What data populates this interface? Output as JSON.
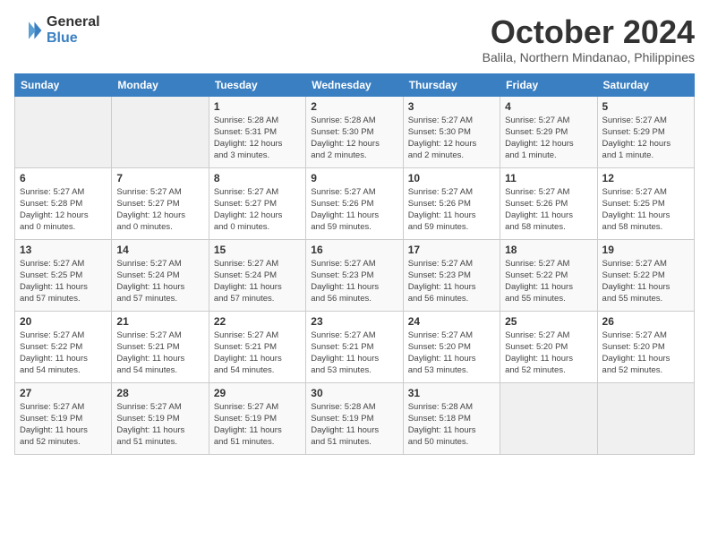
{
  "header": {
    "logo": {
      "general": "General",
      "blue": "Blue"
    },
    "title": "October 2024",
    "subtitle": "Balila, Northern Mindanao, Philippines"
  },
  "calendar": {
    "headers": [
      "Sunday",
      "Monday",
      "Tuesday",
      "Wednesday",
      "Thursday",
      "Friday",
      "Saturday"
    ],
    "weeks": [
      [
        {
          "day": "",
          "info": ""
        },
        {
          "day": "",
          "info": ""
        },
        {
          "day": "1",
          "info": "Sunrise: 5:28 AM\nSunset: 5:31 PM\nDaylight: 12 hours\nand 3 minutes."
        },
        {
          "day": "2",
          "info": "Sunrise: 5:28 AM\nSunset: 5:30 PM\nDaylight: 12 hours\nand 2 minutes."
        },
        {
          "day": "3",
          "info": "Sunrise: 5:27 AM\nSunset: 5:30 PM\nDaylight: 12 hours\nand 2 minutes."
        },
        {
          "day": "4",
          "info": "Sunrise: 5:27 AM\nSunset: 5:29 PM\nDaylight: 12 hours\nand 1 minute."
        },
        {
          "day": "5",
          "info": "Sunrise: 5:27 AM\nSunset: 5:29 PM\nDaylight: 12 hours\nand 1 minute."
        }
      ],
      [
        {
          "day": "6",
          "info": "Sunrise: 5:27 AM\nSunset: 5:28 PM\nDaylight: 12 hours\nand 0 minutes."
        },
        {
          "day": "7",
          "info": "Sunrise: 5:27 AM\nSunset: 5:27 PM\nDaylight: 12 hours\nand 0 minutes."
        },
        {
          "day": "8",
          "info": "Sunrise: 5:27 AM\nSunset: 5:27 PM\nDaylight: 12 hours\nand 0 minutes."
        },
        {
          "day": "9",
          "info": "Sunrise: 5:27 AM\nSunset: 5:26 PM\nDaylight: 11 hours\nand 59 minutes."
        },
        {
          "day": "10",
          "info": "Sunrise: 5:27 AM\nSunset: 5:26 PM\nDaylight: 11 hours\nand 59 minutes."
        },
        {
          "day": "11",
          "info": "Sunrise: 5:27 AM\nSunset: 5:26 PM\nDaylight: 11 hours\nand 58 minutes."
        },
        {
          "day": "12",
          "info": "Sunrise: 5:27 AM\nSunset: 5:25 PM\nDaylight: 11 hours\nand 58 minutes."
        }
      ],
      [
        {
          "day": "13",
          "info": "Sunrise: 5:27 AM\nSunset: 5:25 PM\nDaylight: 11 hours\nand 57 minutes."
        },
        {
          "day": "14",
          "info": "Sunrise: 5:27 AM\nSunset: 5:24 PM\nDaylight: 11 hours\nand 57 minutes."
        },
        {
          "day": "15",
          "info": "Sunrise: 5:27 AM\nSunset: 5:24 PM\nDaylight: 11 hours\nand 57 minutes."
        },
        {
          "day": "16",
          "info": "Sunrise: 5:27 AM\nSunset: 5:23 PM\nDaylight: 11 hours\nand 56 minutes."
        },
        {
          "day": "17",
          "info": "Sunrise: 5:27 AM\nSunset: 5:23 PM\nDaylight: 11 hours\nand 56 minutes."
        },
        {
          "day": "18",
          "info": "Sunrise: 5:27 AM\nSunset: 5:22 PM\nDaylight: 11 hours\nand 55 minutes."
        },
        {
          "day": "19",
          "info": "Sunrise: 5:27 AM\nSunset: 5:22 PM\nDaylight: 11 hours\nand 55 minutes."
        }
      ],
      [
        {
          "day": "20",
          "info": "Sunrise: 5:27 AM\nSunset: 5:22 PM\nDaylight: 11 hours\nand 54 minutes."
        },
        {
          "day": "21",
          "info": "Sunrise: 5:27 AM\nSunset: 5:21 PM\nDaylight: 11 hours\nand 54 minutes."
        },
        {
          "day": "22",
          "info": "Sunrise: 5:27 AM\nSunset: 5:21 PM\nDaylight: 11 hours\nand 54 minutes."
        },
        {
          "day": "23",
          "info": "Sunrise: 5:27 AM\nSunset: 5:21 PM\nDaylight: 11 hours\nand 53 minutes."
        },
        {
          "day": "24",
          "info": "Sunrise: 5:27 AM\nSunset: 5:20 PM\nDaylight: 11 hours\nand 53 minutes."
        },
        {
          "day": "25",
          "info": "Sunrise: 5:27 AM\nSunset: 5:20 PM\nDaylight: 11 hours\nand 52 minutes."
        },
        {
          "day": "26",
          "info": "Sunrise: 5:27 AM\nSunset: 5:20 PM\nDaylight: 11 hours\nand 52 minutes."
        }
      ],
      [
        {
          "day": "27",
          "info": "Sunrise: 5:27 AM\nSunset: 5:19 PM\nDaylight: 11 hours\nand 52 minutes."
        },
        {
          "day": "28",
          "info": "Sunrise: 5:27 AM\nSunset: 5:19 PM\nDaylight: 11 hours\nand 51 minutes."
        },
        {
          "day": "29",
          "info": "Sunrise: 5:27 AM\nSunset: 5:19 PM\nDaylight: 11 hours\nand 51 minutes."
        },
        {
          "day": "30",
          "info": "Sunrise: 5:28 AM\nSunset: 5:19 PM\nDaylight: 11 hours\nand 51 minutes."
        },
        {
          "day": "31",
          "info": "Sunrise: 5:28 AM\nSunset: 5:18 PM\nDaylight: 11 hours\nand 50 minutes."
        },
        {
          "day": "",
          "info": ""
        },
        {
          "day": "",
          "info": ""
        }
      ]
    ]
  }
}
